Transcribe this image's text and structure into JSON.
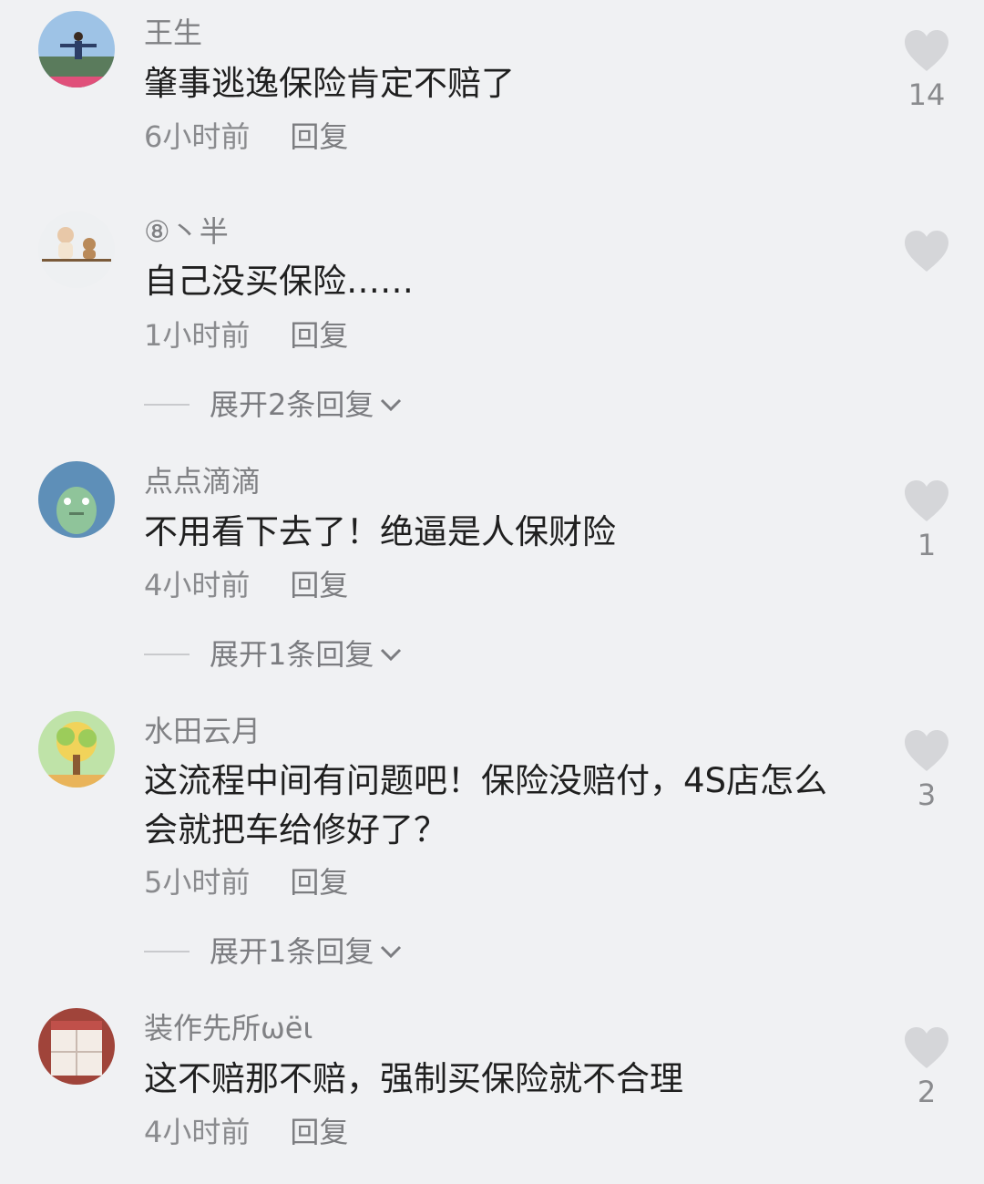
{
  "comments": [
    {
      "name": "王生",
      "text": "肇事逃逸保险肯定不赔了",
      "time": "6小时前",
      "reply": "回复",
      "likes": "14",
      "expand": ""
    },
    {
      "name": "⑧丶半",
      "text": "自己没买保险……",
      "time": "1小时前",
      "reply": "回复",
      "likes": "",
      "expand": "展开2条回复"
    },
    {
      "name": "点点滴滴",
      "text": "不用看下去了！绝逼是人保财险",
      "time": "4小时前",
      "reply": "回复",
      "likes": "1",
      "expand": "展开1条回复"
    },
    {
      "name": "水田云月",
      "text": "这流程中间有问题吧！保险没赔付，4S店怎么会就把车给修好了？",
      "time": "5小时前",
      "reply": "回复",
      "likes": "3",
      "expand": "展开1条回复"
    },
    {
      "name": "装作先所ωëι",
      "text": "这不赔那不赔，强制买保险就不合理",
      "time": "4小时前",
      "reply": "回复",
      "likes": "2",
      "expand": ""
    }
  ],
  "icons": {
    "like": "heart-icon",
    "expand": "chevron-down-icon"
  },
  "colors": {
    "heart": "#d5d6d9",
    "secondary_text": "#8a8b8e",
    "primary_text": "#1f1f1f"
  }
}
